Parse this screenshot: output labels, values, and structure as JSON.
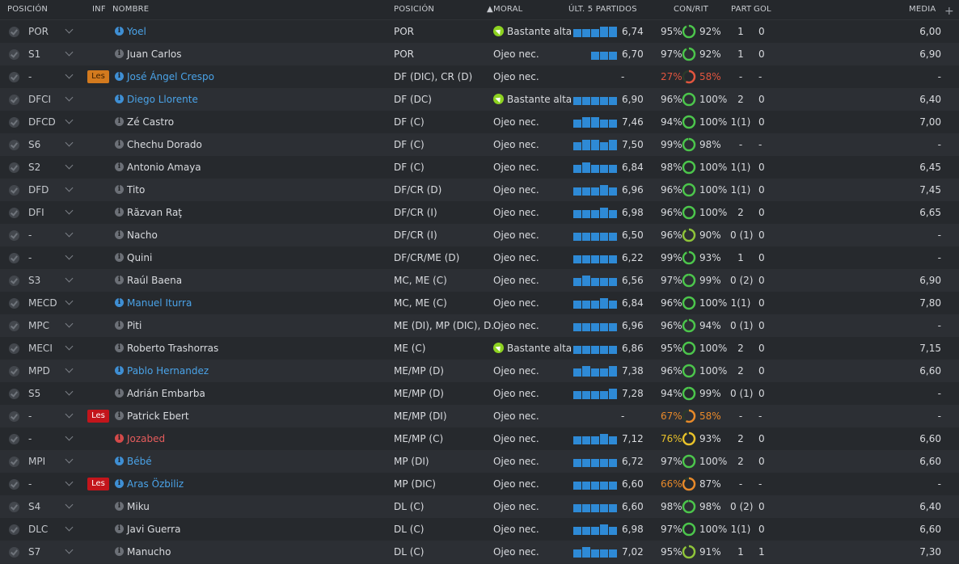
{
  "header": {
    "posicion": "POSICIÓN",
    "inf": "INF",
    "nombre": "NOMBRE",
    "posicion2": "POSICIÓN",
    "moral": "MORAL",
    "ult5": "ÚLT. 5 PARTIDOS",
    "conrit": "CON/RIT",
    "part": "PART",
    "gol": "GOL",
    "media": "MEDIA",
    "add": "+"
  },
  "icons": {
    "check": "check-circle-icon",
    "chevron": "chevron-down-icon",
    "info": "info-icon",
    "morale": "morale-up-icon",
    "ring": "fitness-ring-icon"
  },
  "colors": {
    "bar": "#2e8ad6",
    "ring_green": "#4cc54c",
    "ring_orange": "#e8892a",
    "ring_red": "#e2553f",
    "ring_yellow": "#e8c12a",
    "badge_orange": "#d37a1e",
    "badge_red": "#c3151b"
  },
  "rows": [
    {
      "pos": "POR",
      "inf": "",
      "name": "Yoel",
      "info": "blue",
      "name_color": "blue",
      "position": "POR",
      "morale": "Bastante alta",
      "morale_icon": true,
      "form": [
        2,
        2,
        2,
        3,
        3
      ],
      "avg": "6,74",
      "con": "95%",
      "rit": "92%",
      "ring_color": "green",
      "rit_level": 0.92,
      "part": "1",
      "gol": "0",
      "media": "6,00"
    },
    {
      "pos": "S1",
      "inf": "",
      "name": "Juan Carlos",
      "info": "grey",
      "name_color": "white",
      "position": "POR",
      "morale": "Ojeo nec.",
      "morale_icon": false,
      "form": [
        0,
        0,
        2,
        2,
        2
      ],
      "avg": "6,70",
      "con": "97%",
      "rit": "92%",
      "ring_color": "green",
      "rit_level": 0.92,
      "part": "1",
      "gol": "0",
      "media": "6,90"
    },
    {
      "pos": "-",
      "inf": "Les",
      "inf_color": "orange",
      "name": "José Ángel Crespo",
      "info": "blue",
      "name_color": "blue",
      "position": "DF (DIC), CR (D)",
      "morale": "Ojeo nec.",
      "morale_icon": false,
      "form": [],
      "avg": "-",
      "con": "27%",
      "con_color": "red",
      "rit": "58%",
      "rit_color": "red",
      "ring_color": "red",
      "rit_level": 0.58,
      "part": "-",
      "gol": "-",
      "media": "-"
    },
    {
      "pos": "DFCI",
      "inf": "",
      "name": "Diego Llorente",
      "info": "blue",
      "name_color": "blue",
      "position": "DF (DC)",
      "morale": "Bastante alta",
      "morale_icon": true,
      "form": [
        2,
        2,
        2,
        2,
        2
      ],
      "avg": "6,90",
      "con": "96%",
      "rit": "100%",
      "ring_color": "green",
      "rit_level": 1.0,
      "part": "2",
      "gol": "0",
      "media": "6,40"
    },
    {
      "pos": "DFCD",
      "inf": "",
      "name": "Zé Castro",
      "info": "grey",
      "name_color": "white",
      "position": "DF (C)",
      "morale": "Ojeo nec.",
      "morale_icon": false,
      "form": [
        2,
        3,
        3,
        2,
        2
      ],
      "avg": "7,46",
      "con": "94%",
      "rit": "100%",
      "ring_color": "green",
      "rit_level": 1.0,
      "part": "1(1)",
      "gol": "0",
      "media": "7,00"
    },
    {
      "pos": "S6",
      "inf": "",
      "name": "Chechu Dorado",
      "info": "grey",
      "name_color": "white",
      "position": "DF (C)",
      "morale": "Ojeo nec.",
      "morale_icon": false,
      "form": [
        2,
        3,
        3,
        2,
        3
      ],
      "avg": "7,50",
      "con": "99%",
      "rit": "98%",
      "ring_color": "green",
      "rit_level": 0.98,
      "part": "-",
      "gol": "-",
      "media": "-"
    },
    {
      "pos": "S2",
      "inf": "",
      "name": "Antonio Amaya",
      "info": "grey",
      "name_color": "white",
      "position": "DF (C)",
      "morale": "Ojeo nec.",
      "morale_icon": false,
      "form": [
        2,
        3,
        2,
        2,
        2
      ],
      "avg": "6,84",
      "con": "98%",
      "rit": "100%",
      "ring_color": "green",
      "rit_level": 1.0,
      "part": "1(1)",
      "gol": "0",
      "media": "6,45"
    },
    {
      "pos": "DFD",
      "inf": "",
      "name": "Tito",
      "info": "grey",
      "name_color": "white",
      "position": "DF/CR (D)",
      "morale": "Ojeo nec.",
      "morale_icon": false,
      "form": [
        2,
        2,
        2,
        3,
        2
      ],
      "avg": "6,96",
      "con": "96%",
      "rit": "100%",
      "ring_color": "green",
      "rit_level": 1.0,
      "part": "1(1)",
      "gol": "0",
      "media": "7,45"
    },
    {
      "pos": "DFI",
      "inf": "",
      "name": "Răzvan Raţ",
      "info": "grey",
      "name_color": "white",
      "position": "DF/CR (I)",
      "morale": "Ojeo nec.",
      "morale_icon": false,
      "form": [
        2,
        2,
        2,
        3,
        2
      ],
      "avg": "6,98",
      "con": "96%",
      "rit": "100%",
      "ring_color": "green",
      "rit_level": 1.0,
      "part": "2",
      "gol": "0",
      "media": "6,65"
    },
    {
      "pos": "-",
      "inf": "",
      "name": "Nacho",
      "info": "grey",
      "name_color": "white",
      "position": "DF/CR (I)",
      "morale": "Ojeo nec.",
      "morale_icon": false,
      "form": [
        2,
        2,
        2,
        2,
        2
      ],
      "avg": "6,50",
      "con": "96%",
      "rit": "90%",
      "ring_color": "yellowgreen",
      "rit_level": 0.9,
      "part": "0 (1)",
      "gol": "0",
      "media": "-"
    },
    {
      "pos": "-",
      "inf": "",
      "name": "Quini",
      "info": "grey",
      "name_color": "white",
      "position": "DF/CR/ME (D)",
      "morale": "Ojeo nec.",
      "morale_icon": false,
      "form": [
        2,
        2,
        2,
        2,
        2
      ],
      "avg": "6,22",
      "con": "99%",
      "rit": "93%",
      "ring_color": "green",
      "rit_level": 0.93,
      "part": "1",
      "gol": "0",
      "media": "-"
    },
    {
      "pos": "S3",
      "inf": "",
      "name": "Raúl Baena",
      "info": "grey",
      "name_color": "white",
      "position": "MC, ME (C)",
      "morale": "Ojeo nec.",
      "morale_icon": false,
      "form": [
        2,
        3,
        2,
        2,
        2
      ],
      "avg": "6,56",
      "con": "97%",
      "rit": "99%",
      "ring_color": "green",
      "rit_level": 0.99,
      "part": "0 (2)",
      "gol": "0",
      "media": "6,90"
    },
    {
      "pos": "MECD",
      "inf": "",
      "name": "Manuel Iturra",
      "info": "blue",
      "name_color": "blue",
      "position": "MC, ME (C)",
      "morale": "Ojeo nec.",
      "morale_icon": false,
      "form": [
        2,
        2,
        2,
        3,
        2
      ],
      "avg": "6,84",
      "con": "96%",
      "rit": "100%",
      "ring_color": "green",
      "rit_level": 1.0,
      "part": "1(1)",
      "gol": "0",
      "media": "7,80"
    },
    {
      "pos": "MPC",
      "inf": "",
      "name": "Piti",
      "info": "grey",
      "name_color": "white",
      "position": "ME (DI), MP (DIC), D...",
      "morale": "Ojeo nec.",
      "morale_icon": false,
      "form": [
        2,
        2,
        2,
        2,
        2
      ],
      "avg": "6,96",
      "con": "96%",
      "rit": "94%",
      "ring_color": "green",
      "rit_level": 0.94,
      "part": "0 (1)",
      "gol": "0",
      "media": "-"
    },
    {
      "pos": "MECI",
      "inf": "",
      "name": "Roberto Trashorras",
      "info": "grey",
      "name_color": "white",
      "position": "ME (C)",
      "morale": "Bastante alta",
      "morale_icon": true,
      "form": [
        2,
        2,
        2,
        2,
        2
      ],
      "avg": "6,86",
      "con": "95%",
      "rit": "100%",
      "ring_color": "green",
      "rit_level": 1.0,
      "part": "2",
      "gol": "0",
      "media": "7,15"
    },
    {
      "pos": "MPD",
      "inf": "",
      "name": "Pablo Hernandez",
      "info": "blue",
      "name_color": "blue",
      "position": "ME/MP (D)",
      "morale": "Ojeo nec.",
      "morale_icon": false,
      "form": [
        2,
        3,
        2,
        2,
        3
      ],
      "avg": "7,38",
      "con": "96%",
      "rit": "100%",
      "ring_color": "green",
      "rit_level": 1.0,
      "part": "2",
      "gol": "0",
      "media": "6,60"
    },
    {
      "pos": "S5",
      "inf": "",
      "name": "Adrián Embarba",
      "info": "grey",
      "name_color": "white",
      "position": "ME/MP (D)",
      "morale": "Ojeo nec.",
      "morale_icon": false,
      "form": [
        2,
        2,
        2,
        2,
        3
      ],
      "avg": "7,28",
      "con": "94%",
      "rit": "99%",
      "ring_color": "green",
      "rit_level": 0.99,
      "part": "0 (1)",
      "gol": "0",
      "media": "-"
    },
    {
      "pos": "-",
      "inf": "Les",
      "inf_color": "red",
      "name": "Patrick Ebert",
      "info": "grey",
      "name_color": "white",
      "position": "ME/MP (DI)",
      "morale": "Ojeo nec.",
      "morale_icon": false,
      "form": [],
      "avg": "-",
      "con": "67%",
      "con_color": "orange",
      "rit": "58%",
      "rit_color": "orange",
      "ring_color": "orange",
      "rit_level": 0.58,
      "part": "-",
      "gol": "-",
      "media": "-"
    },
    {
      "pos": "-",
      "inf": "",
      "name": "Jozabed",
      "info": "red",
      "name_color": "red",
      "position": "ME/MP (C)",
      "morale": "Ojeo nec.",
      "morale_icon": false,
      "form": [
        2,
        2,
        2,
        3,
        2
      ],
      "avg": "7,12",
      "con": "76%",
      "con_color": "yellow",
      "rit": "93%",
      "ring_color": "yellow",
      "rit_level": 0.93,
      "part": "2",
      "gol": "0",
      "media": "6,60"
    },
    {
      "pos": "MPI",
      "inf": "",
      "name": "Bébé",
      "info": "blue",
      "name_color": "blue",
      "position": "MP (DI)",
      "morale": "Ojeo nec.",
      "morale_icon": false,
      "form": [
        2,
        2,
        2,
        2,
        2
      ],
      "avg": "6,72",
      "con": "97%",
      "rit": "100%",
      "ring_color": "green",
      "rit_level": 1.0,
      "part": "2",
      "gol": "0",
      "media": "6,60"
    },
    {
      "pos": "-",
      "inf": "Les",
      "inf_color": "red",
      "name": "Aras Özbiliz",
      "info": "blue",
      "name_color": "blue",
      "position": "MP (DIC)",
      "morale": "Ojeo nec.",
      "morale_icon": false,
      "form": [
        2,
        2,
        2,
        2,
        2
      ],
      "avg": "6,60",
      "con": "66%",
      "con_color": "orange",
      "rit": "87%",
      "ring_color": "orange",
      "rit_level": 0.87,
      "part": "-",
      "gol": "-",
      "media": "-"
    },
    {
      "pos": "S4",
      "inf": "",
      "name": "Miku",
      "info": "grey",
      "name_color": "white",
      "position": "DL (C)",
      "morale": "Ojeo nec.",
      "morale_icon": false,
      "form": [
        2,
        2,
        2,
        2,
        2
      ],
      "avg": "6,60",
      "con": "98%",
      "rit": "98%",
      "ring_color": "green",
      "rit_level": 0.98,
      "part": "0 (2)",
      "gol": "0",
      "media": "6,40"
    },
    {
      "pos": "DLC",
      "inf": "",
      "name": "Javi Guerra",
      "info": "grey",
      "name_color": "white",
      "position": "DL (C)",
      "morale": "Ojeo nec.",
      "morale_icon": false,
      "form": [
        2,
        2,
        2,
        3,
        2
      ],
      "avg": "6,98",
      "con": "97%",
      "rit": "100%",
      "ring_color": "green",
      "rit_level": 1.0,
      "part": "1(1)",
      "gol": "0",
      "media": "6,60"
    },
    {
      "pos": "S7",
      "inf": "",
      "name": "Manucho",
      "info": "grey",
      "name_color": "white",
      "position": "DL (C)",
      "morale": "Ojeo nec.",
      "morale_icon": false,
      "form": [
        2,
        3,
        2,
        2,
        2
      ],
      "avg": "7,02",
      "con": "95%",
      "rit": "91%",
      "ring_color": "yellowgreen",
      "rit_level": 0.91,
      "part": "1",
      "gol": "1",
      "media": "7,30"
    }
  ]
}
